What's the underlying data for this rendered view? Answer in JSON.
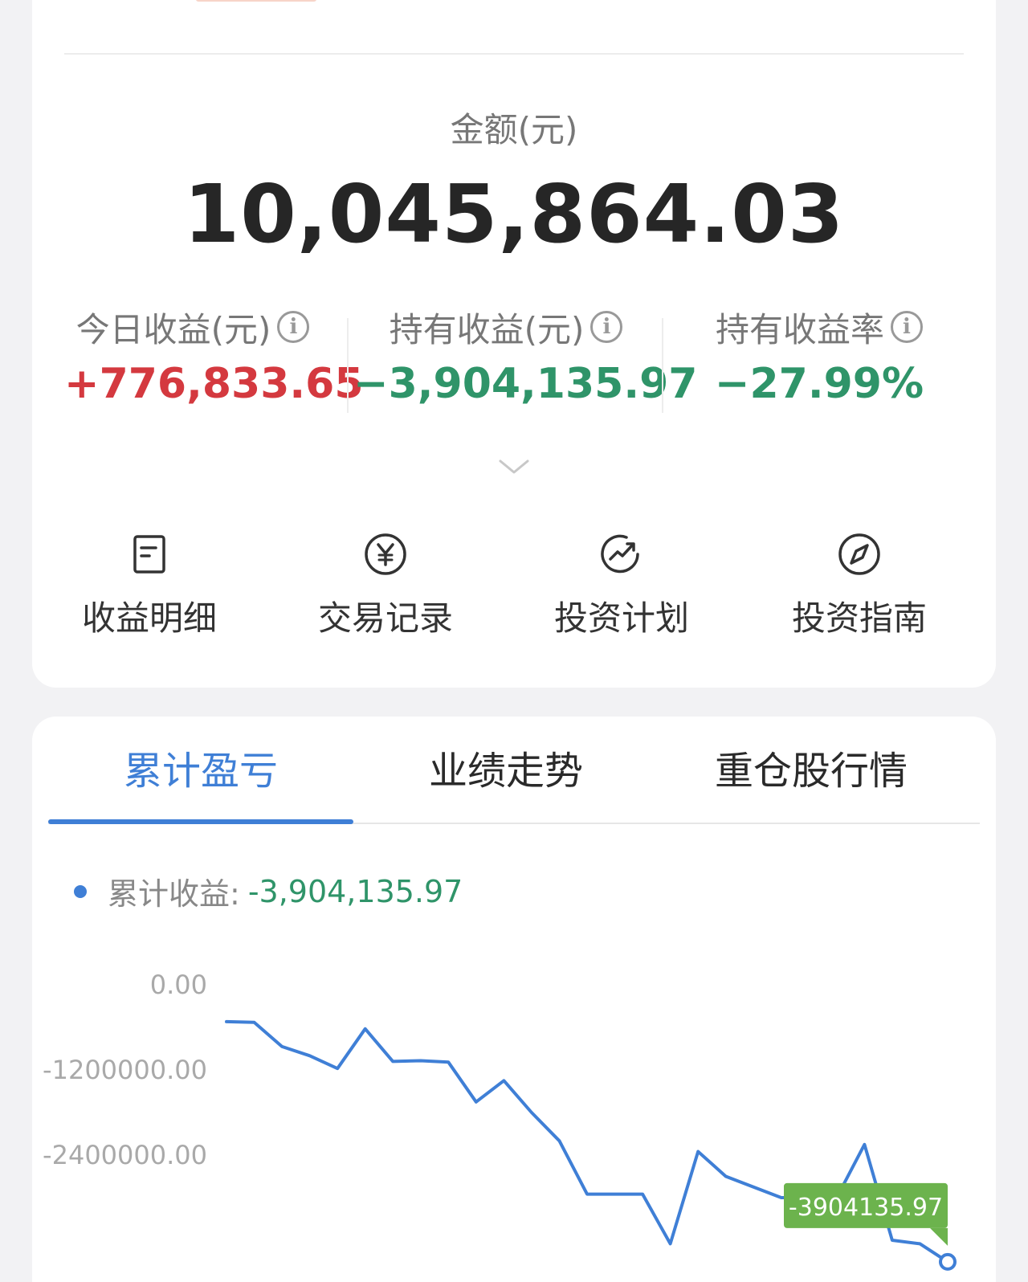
{
  "summary": {
    "amount_label": "金额(元)",
    "amount_value": "10,045,864.03",
    "stats": [
      {
        "label": "今日收益(元)",
        "value": "+776,833.65",
        "color": "#d4393f"
      },
      {
        "label": "持有收益(元)",
        "value": "−3,904,135.97",
        "color": "#2f9469"
      },
      {
        "label": "持有收益率",
        "value": "−27.99%",
        "color": "#2f9469"
      }
    ],
    "actions": [
      {
        "label": "收益明细",
        "icon": "document-icon"
      },
      {
        "label": "交易记录",
        "icon": "yuan-circle-icon"
      },
      {
        "label": "投资计划",
        "icon": "trend-up-icon"
      },
      {
        "label": "投资指南",
        "icon": "compass-icon"
      }
    ]
  },
  "tabs": [
    {
      "label": "累计盈亏",
      "active": true
    },
    {
      "label": "业绩走势",
      "active": false
    },
    {
      "label": "重仓股行情",
      "active": false
    }
  ],
  "legend": {
    "label": "累计收益:",
    "value": "-3,904,135.97"
  },
  "chart_data": {
    "type": "line",
    "y_tick_labels": [
      "0.00",
      "-1200000.00",
      "-2400000.00"
    ],
    "ylim": [
      -3700000,
      0
    ],
    "grid": false,
    "series": [
      {
        "color": "#3f7fd6",
        "values": [
          -520000,
          -530000,
          -870000,
          -1000000,
          -1180000,
          -620000,
          -1080000,
          -1070000,
          -1090000,
          -1650000,
          -1350000,
          -1800000,
          -2200000,
          -2950000,
          -2950000,
          -2950000,
          -3650000,
          -2350000,
          -2700000,
          -2850000,
          -3000000,
          -3000000,
          -3000000,
          -2250000,
          -3600000,
          -3650000,
          -3904135.97
        ]
      }
    ],
    "tooltip": {
      "value": "-3904135.97"
    }
  },
  "colors": {
    "accent": "#3f7fd6",
    "gain": "#d4393f",
    "loss": "#2f9469",
    "tooltip": "#6cb34d"
  }
}
